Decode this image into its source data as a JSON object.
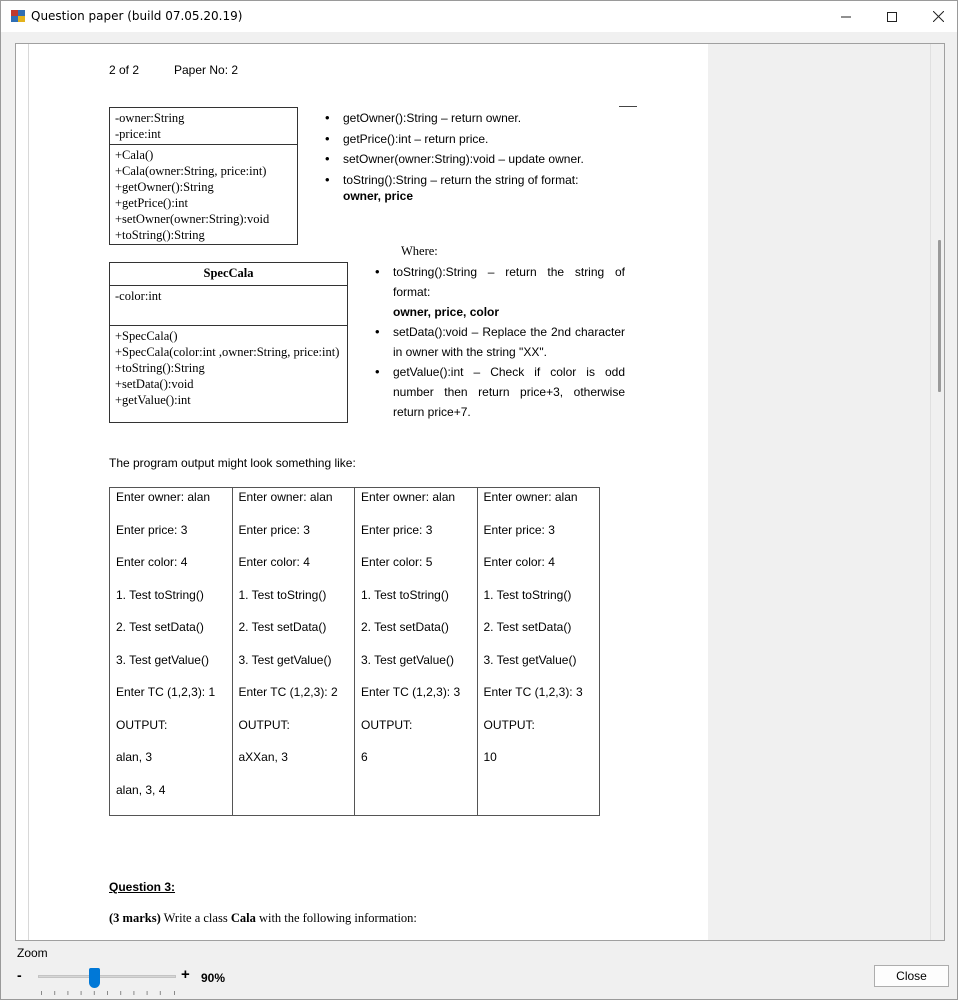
{
  "window": {
    "title": "Question paper (build 07.05.20.19)"
  },
  "paper": {
    "page_label": "2 of 2",
    "paper_no": "Paper No: 2",
    "cala_class": {
      "attributes": [
        "-owner:String",
        "-price:int"
      ],
      "methods": [
        "+Cala()",
        "+Cala(owner:String, price:int)",
        "+getOwner():String",
        "+getPrice():int",
        "+setOwner(owner:String):void",
        "+toString():String"
      ]
    },
    "cala_notes": [
      "getOwner():String – return owner.",
      "getPrice():int – return price.",
      "setOwner(owner:String):void – update owner.",
      "toString():String – return the string of format:"
    ],
    "cala_format": "owner, price",
    "spec_class": {
      "name": "SpecCala",
      "attributes": [
        "-color:int"
      ],
      "methods": [
        "+SpecCala()",
        "+SpecCala(color:int ,owner:String, price:int)",
        "+toString():String",
        "+setData():void",
        "+getValue():int"
      ]
    },
    "where_label": "Where:",
    "spec_notes": [
      {
        "text": "toString():String – return the string of format:",
        "bold": "owner, price, color"
      },
      {
        "text": "setData():void – Replace the 2nd character in owner with the string \"XX\".",
        "bold": ""
      },
      {
        "text": "getValue():int – Check if color is odd number then return price+3, otherwise return price+7.",
        "bold": ""
      }
    ],
    "output_intro": "The program output might look something like:",
    "output_columns": [
      [
        "Enter owner: alan",
        "Enter price: 3",
        "Enter color: 4",
        "1. Test toString()",
        "2. Test setData()",
        "3. Test getValue()",
        "Enter TC (1,2,3): 1",
        "OUTPUT:",
        "alan, 3",
        "alan, 3, 4"
      ],
      [
        "Enter owner: alan",
        "Enter price: 3",
        "Enter color: 4",
        "1. Test toString()",
        "2. Test setData()",
        "3. Test getValue()",
        "Enter TC (1,2,3): 2",
        "OUTPUT:",
        "aXXan, 3"
      ],
      [
        "Enter owner: alan",
        "Enter price: 3",
        "Enter color: 5",
        "1. Test toString()",
        "2. Test setData()",
        "3. Test getValue()",
        "Enter TC (1,2,3): 3",
        "OUTPUT:",
        "6"
      ],
      [
        "Enter owner: alan",
        "Enter price: 3",
        "Enter color: 4",
        "1. Test toString()",
        "2. Test setData()",
        "3. Test getValue()",
        "Enter TC (1,2,3): 3",
        "OUTPUT:",
        "10"
      ]
    ],
    "question_title": "Question 3:",
    "question_marks": "(3 marks)",
    "question_text_before": " Write a class ",
    "question_class": "Cala",
    "question_text_after": " with the following information:"
  },
  "footer": {
    "zoom_label": "Zoom",
    "zoom_minus": "-",
    "zoom_plus": "+",
    "zoom_value": "90%",
    "zoom_level_fraction": 0.4,
    "close_label": "Close"
  },
  "colors": {
    "slider_accent": "#0078d7"
  }
}
